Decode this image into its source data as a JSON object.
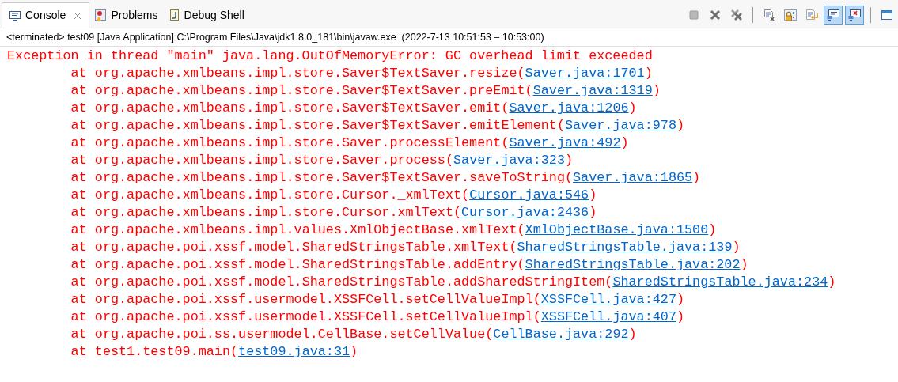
{
  "tabs": [
    {
      "label": "Console",
      "kind": "console",
      "selected": true,
      "closable": true
    },
    {
      "label": "Problems",
      "kind": "problems",
      "selected": false,
      "closable": false
    },
    {
      "label": "Debug Shell",
      "kind": "shell",
      "selected": false,
      "closable": false
    }
  ],
  "toolbar": [
    {
      "kind": "stop",
      "selected": false
    },
    {
      "kind": "remove",
      "selected": false
    },
    {
      "kind": "remove-all",
      "selected": false
    },
    {
      "kind": "separator"
    },
    {
      "kind": "clear",
      "selected": false
    },
    {
      "kind": "lock",
      "selected": false
    },
    {
      "kind": "wrap",
      "selected": false
    },
    {
      "kind": "stdout",
      "selected": true
    },
    {
      "kind": "stderr",
      "selected": true
    },
    {
      "kind": "separator"
    },
    {
      "kind": "window",
      "selected": false
    }
  ],
  "status": "<terminated> test09 [Java Application] C:\\Program Files\\Java\\jdk1.8.0_181\\bin\\javaw.exe  (2022-7-13 10:51:53 – 10:53:00)",
  "lines": [
    {
      "kind": "message",
      "text": "Exception in thread \"main\" java.lang.OutOfMemoryError: GC overhead limit exceeded"
    },
    {
      "kind": "frame",
      "text": "at org.apache.xmlbeans.impl.store.Saver$TextSaver.resize(",
      "link": "Saver.java:1701",
      "suffix": ")"
    },
    {
      "kind": "frame",
      "text": "at org.apache.xmlbeans.impl.store.Saver$TextSaver.preEmit(",
      "link": "Saver.java:1319",
      "suffix": ")"
    },
    {
      "kind": "frame",
      "text": "at org.apache.xmlbeans.impl.store.Saver$TextSaver.emit(",
      "link": "Saver.java:1206",
      "suffix": ")"
    },
    {
      "kind": "frame",
      "text": "at org.apache.xmlbeans.impl.store.Saver$TextSaver.emitElement(",
      "link": "Saver.java:978",
      "suffix": ")"
    },
    {
      "kind": "frame",
      "text": "at org.apache.xmlbeans.impl.store.Saver.processElement(",
      "link": "Saver.java:492",
      "suffix": ")"
    },
    {
      "kind": "frame",
      "text": "at org.apache.xmlbeans.impl.store.Saver.process(",
      "link": "Saver.java:323",
      "suffix": ")"
    },
    {
      "kind": "frame",
      "text": "at org.apache.xmlbeans.impl.store.Saver$TextSaver.saveToString(",
      "link": "Saver.java:1865",
      "suffix": ")"
    },
    {
      "kind": "frame",
      "text": "at org.apache.xmlbeans.impl.store.Cursor._xmlText(",
      "link": "Cursor.java:546",
      "suffix": ")"
    },
    {
      "kind": "frame",
      "text": "at org.apache.xmlbeans.impl.store.Cursor.xmlText(",
      "link": "Cursor.java:2436",
      "suffix": ")"
    },
    {
      "kind": "frame",
      "text": "at org.apache.xmlbeans.impl.values.XmlObjectBase.xmlText(",
      "link": "XmlObjectBase.java:1500",
      "suffix": ")"
    },
    {
      "kind": "frame",
      "text": "at org.apache.poi.xssf.model.SharedStringsTable.xmlText(",
      "link": "SharedStringsTable.java:139",
      "suffix": ")"
    },
    {
      "kind": "frame",
      "text": "at org.apache.poi.xssf.model.SharedStringsTable.addEntry(",
      "link": "SharedStringsTable.java:202",
      "suffix": ")"
    },
    {
      "kind": "frame",
      "text": "at org.apache.poi.xssf.model.SharedStringsTable.addSharedStringItem(",
      "link": "SharedStringsTable.java:234",
      "suffix": ")"
    },
    {
      "kind": "frame",
      "text": "at org.apache.poi.xssf.usermodel.XSSFCell.setCellValueImpl(",
      "link": "XSSFCell.java:427",
      "suffix": ")"
    },
    {
      "kind": "frame",
      "text": "at org.apache.poi.xssf.usermodel.XSSFCell.setCellValueImpl(",
      "link": "XSSFCell.java:407",
      "suffix": ")"
    },
    {
      "kind": "frame",
      "text": "at org.apache.poi.ss.usermodel.CellBase.setCellValue(",
      "link": "CellBase.java:292",
      "suffix": ")"
    },
    {
      "kind": "frame",
      "text": "at test1.test09.main(",
      "link": "test09.java:31",
      "suffix": ")"
    }
  ]
}
